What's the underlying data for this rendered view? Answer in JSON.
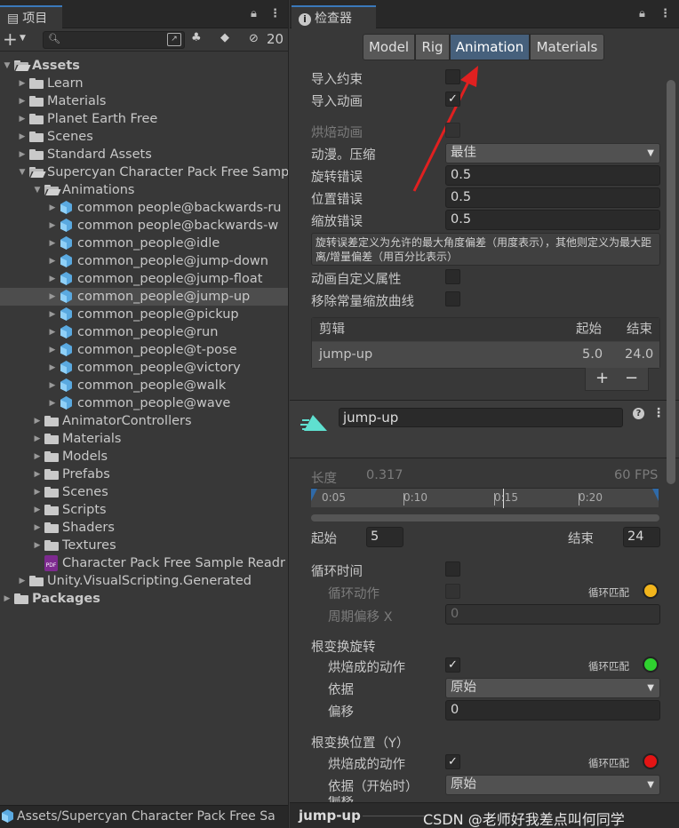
{
  "project_panel": {
    "tab_title": "项目",
    "hidden_count": "20",
    "tree": [
      {
        "label": "Assets",
        "depth": 0,
        "kind": "folder-open",
        "bold": true,
        "expanded": true
      },
      {
        "label": "Learn",
        "depth": 1,
        "kind": "folder"
      },
      {
        "label": "Materials",
        "depth": 1,
        "kind": "folder"
      },
      {
        "label": "Planet Earth Free",
        "depth": 1,
        "kind": "folder"
      },
      {
        "label": "Scenes",
        "depth": 1,
        "kind": "folder"
      },
      {
        "label": "Standard Assets",
        "depth": 1,
        "kind": "folder"
      },
      {
        "label": "Supercyan Character Pack Free Samp",
        "depth": 1,
        "kind": "folder-open",
        "expanded": true
      },
      {
        "label": "Animations",
        "depth": 2,
        "kind": "folder-open",
        "expanded": true
      },
      {
        "label": "common people@backwards-ru",
        "depth": 3,
        "kind": "model"
      },
      {
        "label": "common people@backwards-w",
        "depth": 3,
        "kind": "model"
      },
      {
        "label": "common_people@idle",
        "depth": 3,
        "kind": "model"
      },
      {
        "label": "common_people@jump-down",
        "depth": 3,
        "kind": "model"
      },
      {
        "label": "common_people@jump-float",
        "depth": 3,
        "kind": "model"
      },
      {
        "label": "common_people@jump-up",
        "depth": 3,
        "kind": "model",
        "selected": true
      },
      {
        "label": "common_people@pickup",
        "depth": 3,
        "kind": "model"
      },
      {
        "label": "common_people@run",
        "depth": 3,
        "kind": "model"
      },
      {
        "label": "common_people@t-pose",
        "depth": 3,
        "kind": "model"
      },
      {
        "label": "common_people@victory",
        "depth": 3,
        "kind": "model"
      },
      {
        "label": "common_people@walk",
        "depth": 3,
        "kind": "model"
      },
      {
        "label": "common_people@wave",
        "depth": 3,
        "kind": "model"
      },
      {
        "label": "AnimatorControllers",
        "depth": 2,
        "kind": "folder"
      },
      {
        "label": "Materials",
        "depth": 2,
        "kind": "folder"
      },
      {
        "label": "Models",
        "depth": 2,
        "kind": "folder"
      },
      {
        "label": "Prefabs",
        "depth": 2,
        "kind": "folder"
      },
      {
        "label": "Scenes",
        "depth": 2,
        "kind": "folder"
      },
      {
        "label": "Scripts",
        "depth": 2,
        "kind": "folder"
      },
      {
        "label": "Shaders",
        "depth": 2,
        "kind": "folder"
      },
      {
        "label": "Textures",
        "depth": 2,
        "kind": "folder"
      },
      {
        "label": "Character Pack Free Sample Readr",
        "depth": 2,
        "kind": "pdf",
        "noarrow": true
      },
      {
        "label": "Unity.VisualScripting.Generated",
        "depth": 1,
        "kind": "folder"
      },
      {
        "label": "Packages",
        "depth": 0,
        "kind": "folder",
        "bold": true
      }
    ],
    "status_path": "Assets/Supercyan Character Pack Free Sa"
  },
  "inspector": {
    "tab_title": "检查器",
    "tabs": [
      "Model",
      "Rig",
      "Animation",
      "Materials"
    ],
    "active_tab": "Animation",
    "import_constraints": "导入约束",
    "import_animation": "导入动画",
    "bake_animations": "烘焙动画",
    "anim_compression": "动漫。压缩",
    "anim_compression_value": "最佳",
    "rotation_error": "旋转错误",
    "rotation_error_value": "0.5",
    "position_error": "位置错误",
    "position_error_value": "0.5",
    "scale_error": "缩放错误",
    "scale_error_value": "0.5",
    "help_text": "旋转误差定义为允许的最大角度偏差（用度表示），其他则定义为最大距离/增量偏差（用百分比表示）",
    "anim_custom_props": "动画自定义属性",
    "remove_const_scale": "移除常量缩放曲线",
    "clips_header": {
      "name": "剪辑",
      "start": "起始",
      "end": "结束"
    },
    "clips": [
      {
        "name": "jump-up",
        "start": "5.0",
        "end": "24.0"
      }
    ],
    "plus": "+",
    "minus": "−",
    "clip_name": "jump-up",
    "length_label": "长度",
    "length_value": "0.317",
    "fps": "60 FPS",
    "timeline_ticks": [
      "0:05",
      "0:10",
      "0:15",
      "0:20"
    ],
    "start_label": "起始",
    "start_value": "5",
    "end_label": "结束",
    "end_value": "24",
    "loop_time": "循环时间",
    "loop_pose": "循环动作",
    "loop_match": "循环匹配",
    "cycle_offset": "周期偏移 X",
    "cycle_offset_value": "0",
    "root_rotation": "根变换旋转",
    "bake_into_pose": "烘焙成的动作",
    "based_upon": "依据",
    "based_upon_value": "原始",
    "offset": "偏移",
    "offset_value": "0",
    "root_position_y": "根变换位置（Y）",
    "based_upon_start": "依据（开始时）",
    "based_upon_start_value": "原始",
    "cut_label": "偏移",
    "status_clip": "jump-up",
    "watermark": "CSDN @老师好我差点叫何同学",
    "colors": {
      "loop_yellow": "#f2b51c",
      "loop_green": "#2fd12f",
      "loop_red": "#e41414",
      "accent_blue": "#3a79bb",
      "arrow_red": "#e02020"
    }
  }
}
